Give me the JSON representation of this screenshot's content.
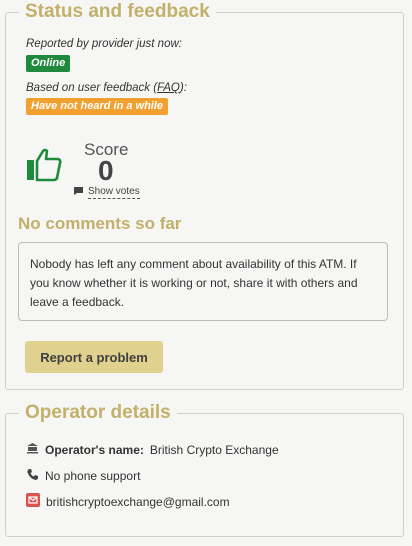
{
  "status": {
    "title": "Status and feedback",
    "provider_label": "Reported by provider just now:",
    "provider_badge": "Online",
    "feedback_label_prefix": "Based on user feedback (",
    "faq_link": "FAQ",
    "feedback_label_suffix": "):",
    "feedback_badge": "Have not heard in a while",
    "score_label": "Score",
    "score_value": "0",
    "show_votes": "Show votes",
    "comments_heading": "No comments so far",
    "comments_text": "Nobody has left any comment about availability of this ATM. If you know whether it is working or not, share it with others and leave a feedback.",
    "report_button": "Report a problem"
  },
  "operator": {
    "title": "Operator details",
    "name_label": "Operator's name:",
    "name_value": "British Crypto Exchange",
    "phone": "No phone support",
    "email": "britishcryptoexchange@gmail.com"
  },
  "colors": {
    "accent": "#c2b06b",
    "online_green": "#1f8a3c",
    "warning_orange": "#f2a02f",
    "thumb_green": "#1f8a3c",
    "button_bg": "#e1d18f",
    "email_red": "#d9534f"
  },
  "icons": {
    "thumb": "thumbs-up-icon",
    "comment": "comment-icon",
    "building": "bank-icon",
    "phone": "phone-icon",
    "email": "envelope-icon"
  }
}
